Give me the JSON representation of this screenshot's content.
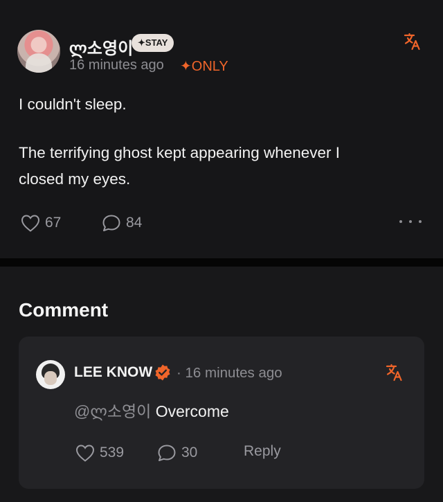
{
  "post": {
    "username": "ლ소영이",
    "membership_badge": "✦STAY",
    "timestamp": "16 minutes ago",
    "only_badge": "✦ONLY",
    "body_line1": "I couldn't sleep.",
    "body_line2": "The terrifying ghost kept appearing whenever I",
    "body_line3": "closed my eyes.",
    "likes": "67",
    "comments": "84"
  },
  "comments_section": {
    "title": "Comment"
  },
  "comment": {
    "username": "LEE KNOW",
    "timestamp": "· 16 minutes ago",
    "mention": "@ლ소영이",
    "text": "Overcome",
    "likes": "539",
    "replies": "30",
    "reply_label": "Reply"
  },
  "colors": {
    "accent": "#f0652a",
    "background": "#161618",
    "card": "#232326",
    "muted_text": "#8d8d92"
  },
  "icons": [
    "heart-icon",
    "speech-bubble-icon",
    "translate-icon",
    "more-icon",
    "verified-badge-icon"
  ]
}
